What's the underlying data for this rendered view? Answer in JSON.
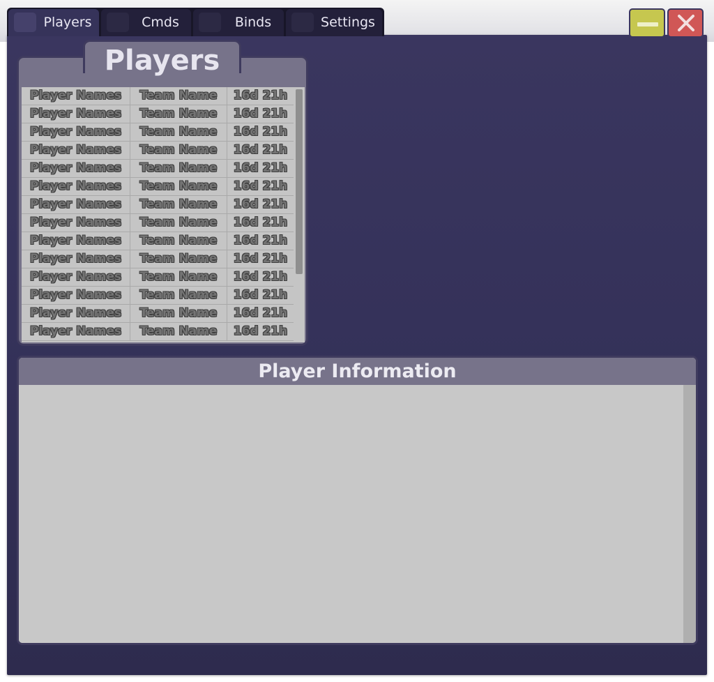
{
  "tabs": [
    {
      "label": "Players",
      "icon": "players-icon",
      "active": true
    },
    {
      "label": "Cmds",
      "icon": "cmds-icon",
      "active": false
    },
    {
      "label": "Binds",
      "icon": "binds-icon",
      "active": false
    },
    {
      "label": "Settings",
      "icon": "settings-icon",
      "active": false
    }
  ],
  "window_controls": {
    "minimize_icon": "minimize-icon",
    "close_icon": "close-icon"
  },
  "players_panel": {
    "title": "Players",
    "rows": [
      {
        "name": "Player Names",
        "team": "Team Name",
        "time": "16d 21h"
      },
      {
        "name": "Player Names",
        "team": "Team Name",
        "time": "16d 21h"
      },
      {
        "name": "Player Names",
        "team": "Team Name",
        "time": "16d 21h"
      },
      {
        "name": "Player Names",
        "team": "Team Name",
        "time": "16d 21h"
      },
      {
        "name": "Player Names",
        "team": "Team Name",
        "time": "16d 21h"
      },
      {
        "name": "Player Names",
        "team": "Team Name",
        "time": "16d 21h"
      },
      {
        "name": "Player Names",
        "team": "Team Name",
        "time": "16d 21h"
      },
      {
        "name": "Player Names",
        "team": "Team Name",
        "time": "16d 21h"
      },
      {
        "name": "Player Names",
        "team": "Team Name",
        "time": "16d 21h"
      },
      {
        "name": "Player Names",
        "team": "Team Name",
        "time": "16d 21h"
      },
      {
        "name": "Player Names",
        "team": "Team Name",
        "time": "16d 21h"
      },
      {
        "name": "Player Names",
        "team": "Team Name",
        "time": "16d 21h"
      },
      {
        "name": "Player Names",
        "team": "Team Name",
        "time": "16d 21h"
      },
      {
        "name": "Player Names",
        "team": "Team Name",
        "time": "16d 21h"
      }
    ]
  },
  "info_panel": {
    "title": "Player Information"
  },
  "colors": {
    "window_bg": "#35325a",
    "panel_header": "#77738a",
    "list_bg": "#c5c5c5",
    "minimize": "#c6c74f",
    "close": "#d05756"
  }
}
